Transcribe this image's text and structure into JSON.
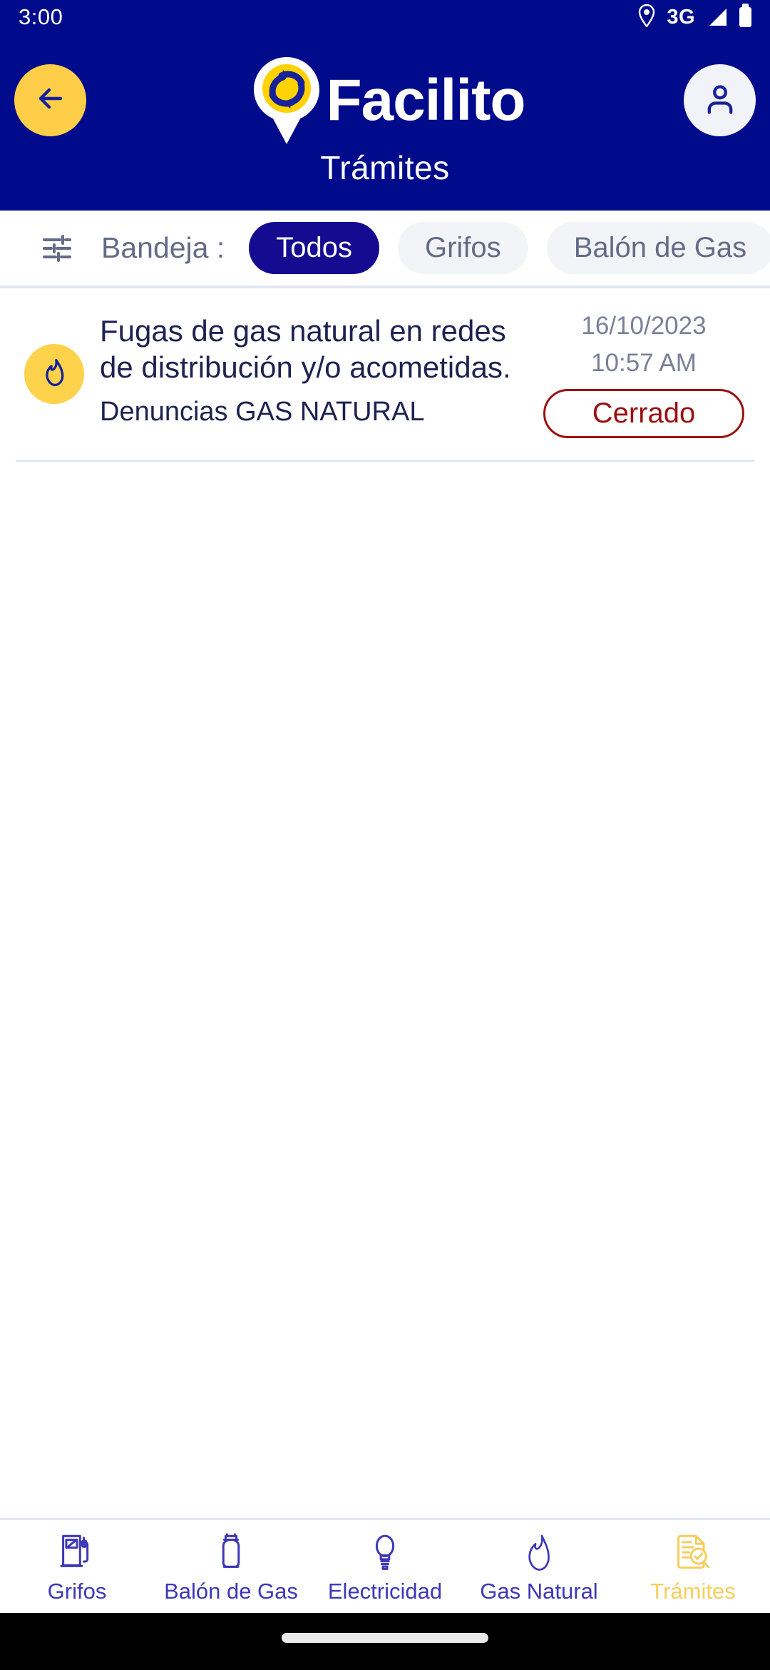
{
  "status_bar": {
    "time": "3:00",
    "network": "3G",
    "icons": [
      "location-pin-icon",
      "signal-icon",
      "battery-icon"
    ]
  },
  "app_bar": {
    "back_icon": "arrow-left-icon",
    "brand_name": "Facilito",
    "logo_icon": "facilito-pin-logo",
    "profile_icon": "user-avatar-icon",
    "page_title": "Trámites",
    "background_color": "#000b8c",
    "accent_color": "#ffce49"
  },
  "filter_bar": {
    "filter_icon": "sliders-filter-icon",
    "label": "Bandeja :",
    "chips": [
      {
        "label": "Todos",
        "active": true
      },
      {
        "label": "Grifos",
        "active": false
      },
      {
        "label": "Balón de Gas",
        "active": false
      }
    ]
  },
  "list": {
    "items": [
      {
        "avatar_icon": "flame-icon",
        "title": "Fugas de gas natural en redes de distribución y/o acometidas.",
        "subtitle": "Denuncias GAS NATURAL",
        "date": "16/10/2023",
        "time": "10:57 AM",
        "status": "Cerrado",
        "status_color": "#9b1010"
      }
    ]
  },
  "bottom_nav": {
    "items": [
      {
        "label": "Grifos",
        "icon": "fuel-pump-icon",
        "active": false
      },
      {
        "label": "Balón de Gas",
        "icon": "gas-cylinder-icon",
        "active": false
      },
      {
        "label": "Electricidad",
        "icon": "light-bulb-icon",
        "active": false
      },
      {
        "label": "Gas Natural",
        "icon": "flame-icon",
        "active": false
      },
      {
        "label": "Trámites",
        "icon": "document-search-icon",
        "active": true
      }
    ],
    "inactive_color": "#3f37b8",
    "active_color": "#f6ce5e"
  }
}
